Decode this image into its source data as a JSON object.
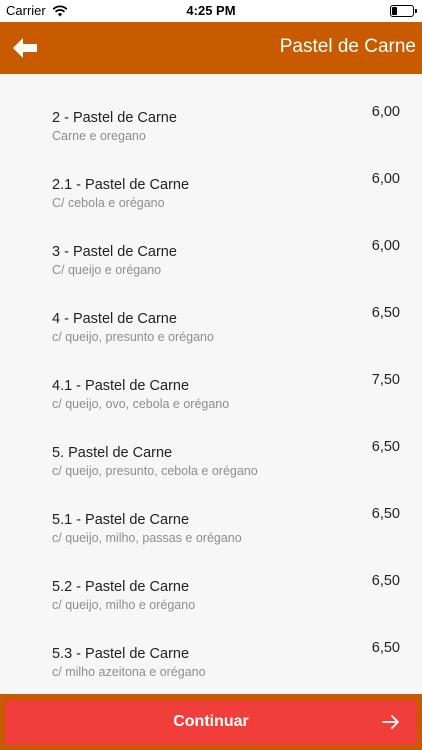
{
  "status_bar": {
    "carrier": "Carrier",
    "time": "4:25 PM",
    "battery_level": 0.25
  },
  "navbar": {
    "back_icon": "arrow-left-icon",
    "title": "Pastel de Carne"
  },
  "items": [
    {
      "name": "2 - Pastel de Carne",
      "desc": "Carne e oregano",
      "price": "6,00"
    },
    {
      "name": "2.1 - Pastel de Carne",
      "desc": "C/ cebola e orégano",
      "price": "6,00"
    },
    {
      "name": "3 - Pastel de Carne",
      "desc": "C/ queijo e orégano",
      "price": "6,00"
    },
    {
      "name": "4 - Pastel de Carne",
      "desc": "c/ queijo, presunto e orégano",
      "price": "6,50"
    },
    {
      "name": "4.1 - Pastel de Carne",
      "desc": "c/ queijo, ovo, cebola e orégano",
      "price": "7,50"
    },
    {
      "name": "5. Pastel de Carne",
      "desc": "c/ queijo, presunto, cebola e orégano",
      "price": "6,50"
    },
    {
      "name": "5.1 - Pastel de Carne",
      "desc": "c/ queijo, milho, passas e orégano",
      "price": "6,50"
    },
    {
      "name": "5.2 - Pastel de Carne",
      "desc": "c/ queijo, milho e orégano",
      "price": "6,50"
    },
    {
      "name": "5.3 - Pastel de Carne",
      "desc": "c/ milho azeitona e orégano",
      "price": "6,50"
    }
  ],
  "footer": {
    "continue_label": "Continuar",
    "continue_icon": "arrow-right-icon"
  },
  "colors": {
    "navbar": "#c85a00",
    "button": "#f03e3a"
  }
}
